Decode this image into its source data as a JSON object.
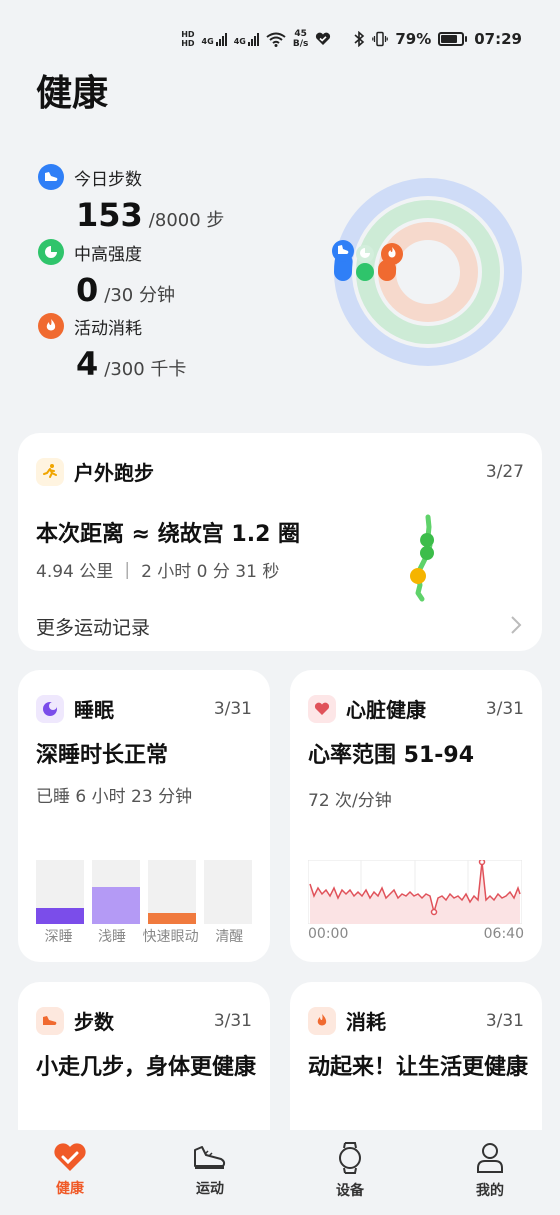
{
  "status_bar": {
    "sim1": "HD",
    "sim2": "HD",
    "net1": "4G",
    "net2": "4G",
    "speed_value": "45",
    "speed_unit": "B/s",
    "battery_pct": "79%",
    "battery_level": 0.79,
    "time": "07:29"
  },
  "page_title": "健康",
  "summary": {
    "steps": {
      "label": "今日步数",
      "value": "153",
      "goal": "/8000 步",
      "color": "#2f7ff7",
      "progress": 0.019
    },
    "intensity": {
      "label": "中高强度",
      "value": "0",
      "goal": "/30 分钟",
      "color": "#2fc46b",
      "progress": 0.0
    },
    "calories": {
      "label": "活动消耗",
      "value": "4",
      "goal": "/300 千卡",
      "color": "#f06a30",
      "progress": 0.013
    }
  },
  "outdoor_run": {
    "title": "户外跑步",
    "date": "3/27",
    "headline": "本次距离 ≈ 绕故宫 1.2 圈",
    "detail": "4.94 公里 ｜ 2 小时 0 分 31 秒",
    "more": "更多运动记录"
  },
  "sleep": {
    "title": "睡眠",
    "date": "3/31",
    "headline": "深睡时长正常",
    "detail": "已睡 6 小时 23 分钟",
    "stages": [
      {
        "label": "深睡",
        "fraction": 0.25,
        "color": "#7b4dea"
      },
      {
        "label": "浅睡",
        "fraction": 0.58,
        "color": "#b49af5"
      },
      {
        "label": "快速眼动",
        "fraction": 0.17,
        "color": "#f07a3e"
      },
      {
        "label": "清醒",
        "fraction": 0.0,
        "color": "#cccccc"
      }
    ]
  },
  "heart": {
    "title": "心脏健康",
    "date": "3/31",
    "headline": "心率范围 51-94",
    "detail": "72 次/分钟",
    "time_start": "00:00",
    "time_end": "06:40",
    "line_color": "#e0525a"
  },
  "steps_card": {
    "title": "步数",
    "date": "3/31",
    "headline": "小走几步，身体更健康"
  },
  "calorie_card": {
    "title": "消耗",
    "date": "3/31",
    "headline": "动起来！让生活更健康"
  },
  "nav": [
    {
      "label": "健康",
      "icon": "heart-icon",
      "active": true
    },
    {
      "label": "运动",
      "icon": "shoe-icon",
      "active": false
    },
    {
      "label": "设备",
      "icon": "watch-icon",
      "active": false
    },
    {
      "label": "我的",
      "icon": "person-icon",
      "active": false
    }
  ],
  "accent": "#f05a28"
}
